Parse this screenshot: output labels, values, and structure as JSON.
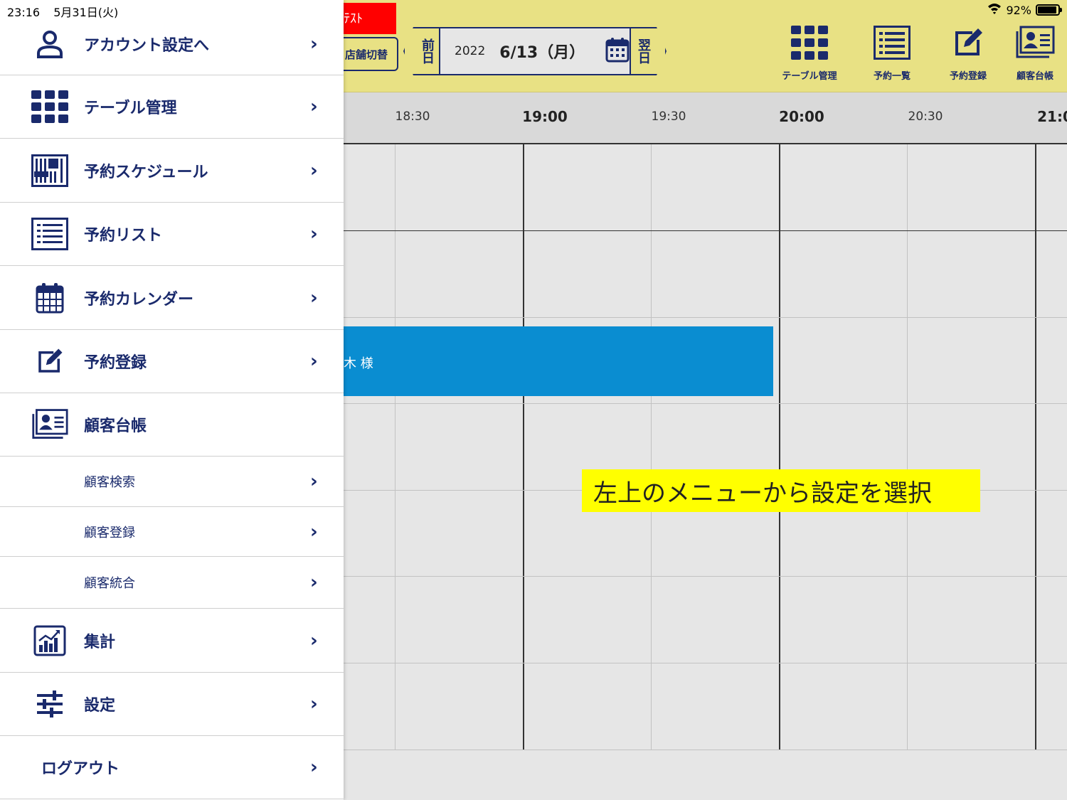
{
  "status": {
    "time": "23:16",
    "date": "5月31日(火)",
    "battery": "92%",
    "battery_fraction": 0.92
  },
  "header": {
    "test_badge": "ﾃｽﾄ",
    "store_switch": "店舗切替",
    "prev_day": "前日",
    "next_day": "翌日",
    "year": "2022",
    "month_day": "6/13（月）",
    "nav": [
      {
        "label": "テーブル管理",
        "icon": "grid-icon"
      },
      {
        "label": "予約一覧",
        "icon": "list-icon"
      },
      {
        "label": "予約登録",
        "icon": "edit-icon"
      },
      {
        "label": "顧客台帳",
        "icon": "contact-card-icon"
      }
    ]
  },
  "timeline": {
    "labels": [
      "18:30",
      "19:00",
      "19:30",
      "20:00",
      "20:30",
      "21:0"
    ]
  },
  "reservation": {
    "name": "木 様"
  },
  "tip": "左上のメニューから設定を選択",
  "menu": {
    "account": "アカウント設定へ",
    "table": "テーブル管理",
    "schedule": "予約スケジュール",
    "list": "予約リスト",
    "calendar": "予約カレンダー",
    "register": "予約登録",
    "customers": "顧客台帳",
    "customer_search": "顧客検索",
    "customer_register": "顧客登録",
    "customer_merge": "顧客統合",
    "stats": "集計",
    "settings": "設定",
    "logout": "ログアウト",
    "chevron": "›"
  }
}
